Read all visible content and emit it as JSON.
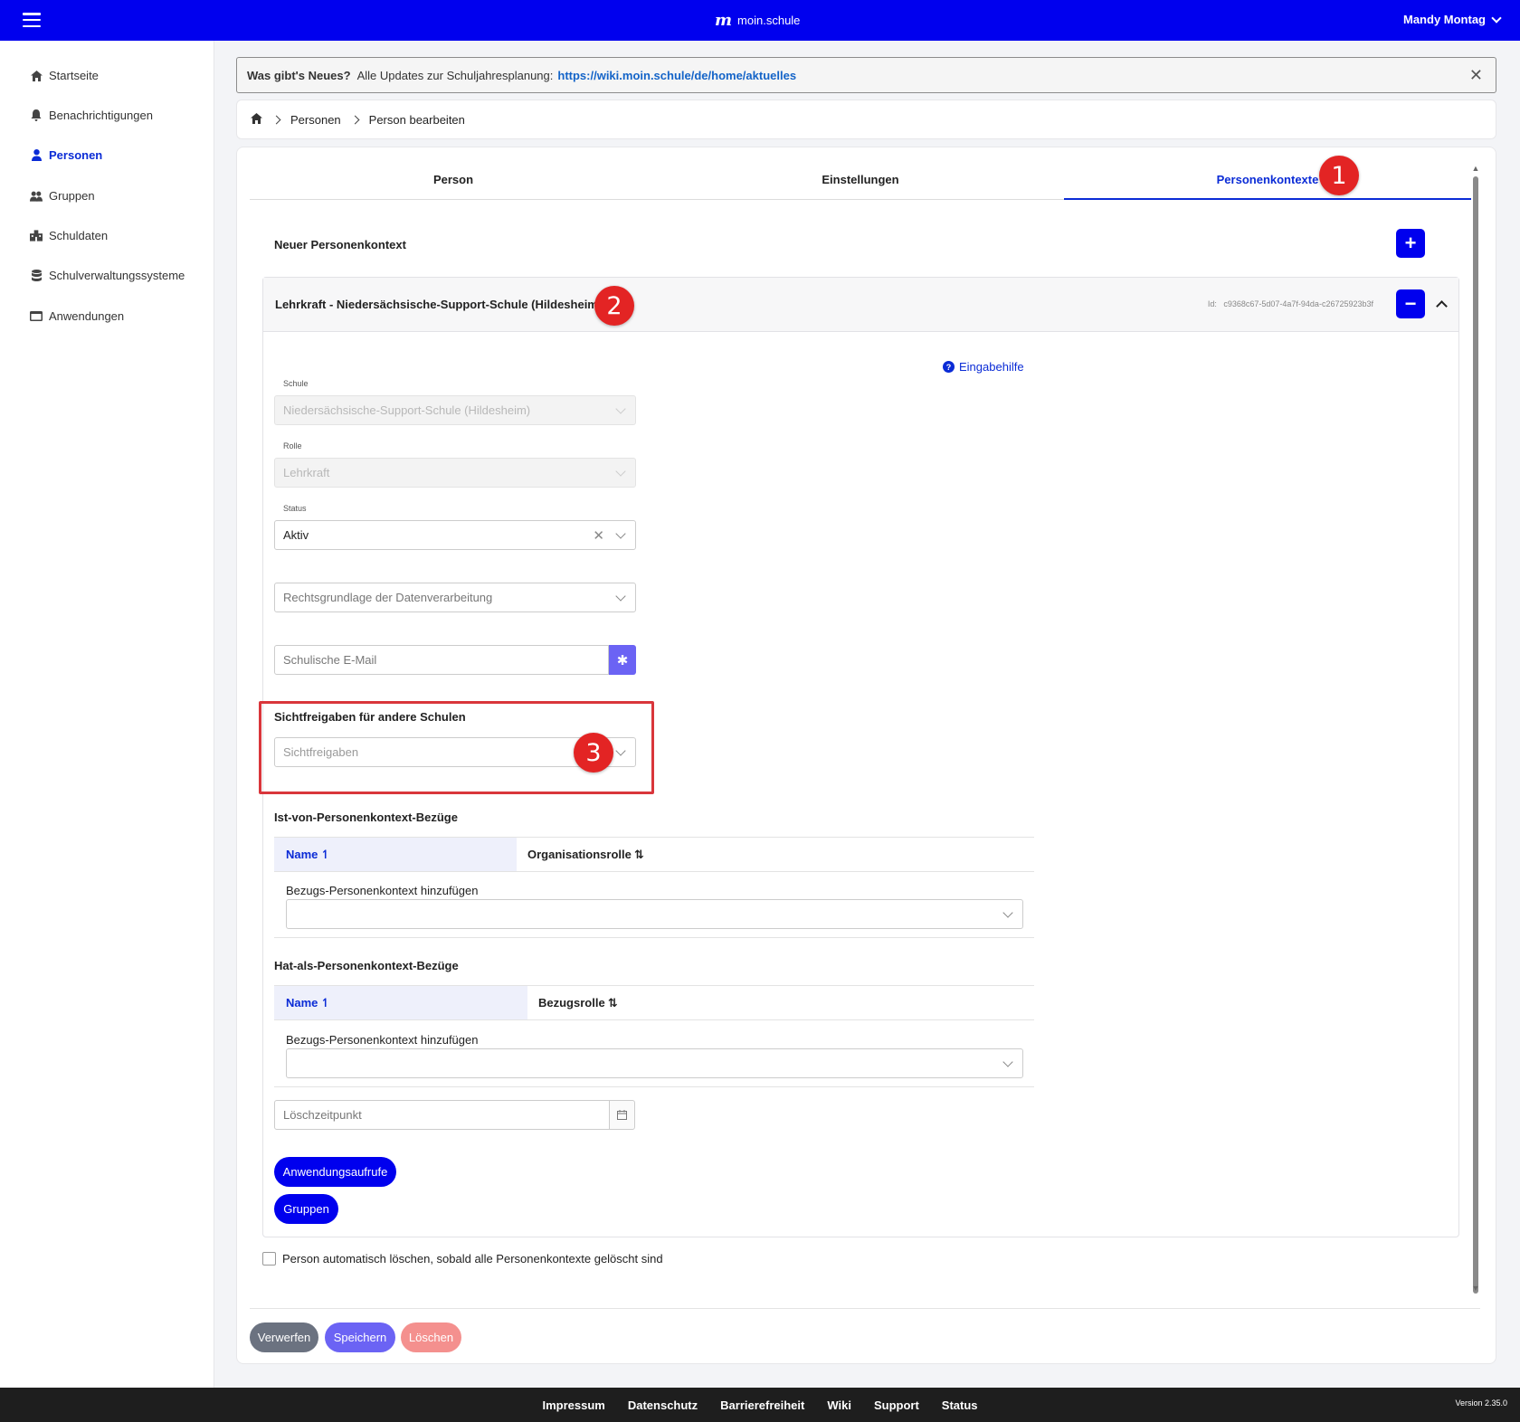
{
  "topbar": {
    "logo_text": "moin.schule",
    "user_name": "Mandy Montag"
  },
  "sidebar": {
    "items": [
      {
        "label": "Startseite",
        "icon": "home-icon"
      },
      {
        "label": "Benachrichtigungen",
        "icon": "bell-icon"
      },
      {
        "label": "Personen",
        "icon": "person-icon",
        "active": true
      },
      {
        "label": "Gruppen",
        "icon": "group-icon"
      },
      {
        "label": "Schuldaten",
        "icon": "school-icon"
      },
      {
        "label": "Schulverwaltungssysteme",
        "icon": "database-icon"
      },
      {
        "label": "Anwendungen",
        "icon": "window-icon"
      }
    ]
  },
  "banner": {
    "title": "Was gibt's Neues?",
    "text": "Alle Updates zur Schuljahresplanung:",
    "link": "https://wiki.moin.schule/de/home/aktuelles"
  },
  "breadcrumb": {
    "items": [
      "Personen",
      "Person bearbeiten"
    ]
  },
  "tabs": [
    "Person",
    "Einstellungen",
    "Personenkontexte"
  ],
  "markers": [
    "1",
    "2",
    "3"
  ],
  "new_context": {
    "label": "Neuer Personenkontext",
    "add_symbol": "+"
  },
  "context": {
    "title": "Lehrkraft - Niedersächsische-Support-Schule (Hildesheim)",
    "id_label": "Id:",
    "id_value": "c9368c67-5d07-4a7f-94da-c26725923b3f",
    "remove_symbol": "−",
    "help_label": "Eingabehilfe",
    "school_label": "Schule",
    "school_value": "Niedersächsische-Support-Schule (Hildesheim)",
    "role_label": "Rolle",
    "role_value": "Lehrkraft",
    "status_label": "Status",
    "status_value": "Aktiv",
    "legal_basis_placeholder": "Rechtsgrundlage der Datenverarbeitung",
    "email_placeholder": "Schulische E-Mail",
    "visibility_heading": "Sichtfreigaben für andere Schulen",
    "visibility_placeholder": "Sichtfreigaben",
    "is_of_heading": "Ist-von-Personenkontext-Bezüge",
    "is_of_col_name": "Name",
    "is_of_col_other": "Organisationsrolle",
    "is_of_add_label": "Bezugs-Personenkontext hinzufügen",
    "has_as_heading": "Hat-als-Personenkontext-Bezüge",
    "has_as_col_name": "Name",
    "has_as_col_other": "Bezugsrolle",
    "has_as_add_label": "Bezugs-Personenkontext hinzufügen",
    "delete_time_placeholder": "Löschzeitpunkt",
    "btn_applications": "Anwendungsaufrufe",
    "btn_groups": "Gruppen"
  },
  "auto_delete_label": "Person automatisch löschen, sobald alle Personenkontexte gelöscht sind",
  "actions": {
    "discard": "Verwerfen",
    "save": "Speichern",
    "delete": "Löschen"
  },
  "footer": {
    "links": [
      "Impressum",
      "Datenschutz",
      "Barrierefreiheit",
      "Wiki",
      "Support",
      "Status"
    ],
    "version": "Version 2.35.0"
  },
  "colors": {
    "primary": "#0000ee",
    "accent": "#0a2bd6",
    "marker": "#e32424",
    "discard": "#6b7280",
    "save": "#6b63f4",
    "delete": "#f4908e"
  }
}
